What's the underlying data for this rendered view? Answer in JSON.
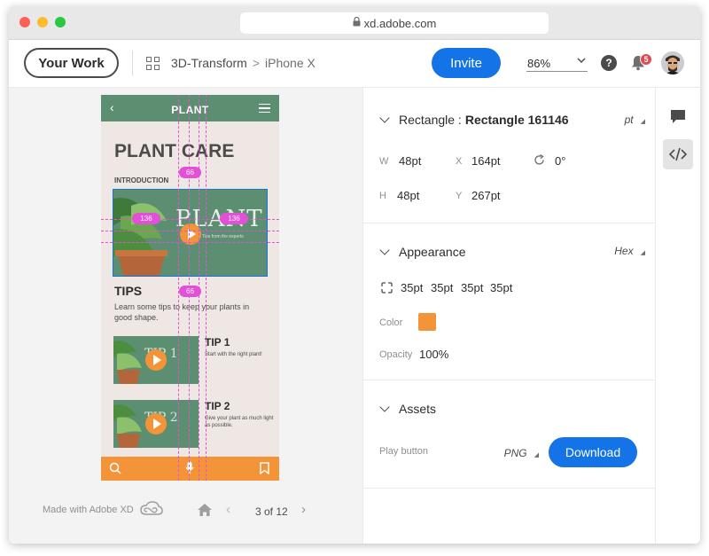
{
  "browser": {
    "url": "xd.adobe.com"
  },
  "header": {
    "your_work": "Your Work",
    "crumb_project": "3D-Transform",
    "crumb_sep": ">",
    "crumb_artboard": "iPhone X",
    "invite": "Invite",
    "zoom": "86%",
    "notifications": "5"
  },
  "phone": {
    "nav_title": "PLANT",
    "heading": "PLANT CARE",
    "intro_label": "INTRODUCTION",
    "hero_word": "PLANT",
    "hero_sub": "Tips from the experts",
    "tips_heading": "TIPS",
    "tips_text": "Learn some tips to keep your plants in good shape.",
    "tips": [
      {
        "word": "TIP 1",
        "title": "TIP 1",
        "text": "Start with the right plant!"
      },
      {
        "word": "TIP 2",
        "title": "TIP 2",
        "text": "Give your plant as much light as possible."
      }
    ],
    "guides": {
      "top": "66",
      "left": "136",
      "right": "136",
      "bottom": "66"
    }
  },
  "preview_footer": {
    "made_with": "Made with Adobe XD",
    "pager": "3 of 12"
  },
  "inspect": {
    "rectangle": {
      "label": "Rectangle : ",
      "name": "Rectangle 161146",
      "unit": "pt",
      "w_label": "W",
      "w": "48pt",
      "x_label": "X",
      "x": "164pt",
      "rotation": "0°",
      "h_label": "H",
      "h": "48pt",
      "y_label": "Y",
      "y": "267pt"
    },
    "appearance": {
      "title": "Appearance",
      "unit": "Hex",
      "radii": [
        "35pt",
        "35pt",
        "35pt",
        "35pt"
      ],
      "color_label": "Color",
      "color": "#F39438",
      "opacity_label": "Opacity",
      "opacity": "100%"
    },
    "assets": {
      "title": "Assets",
      "item": "Play button",
      "format": "PNG",
      "download": "Download"
    }
  },
  "colors": {
    "accent": "#1473E6",
    "plant_green": "#5C8F72",
    "orange": "#F39438",
    "guide": "#E44FD8"
  }
}
